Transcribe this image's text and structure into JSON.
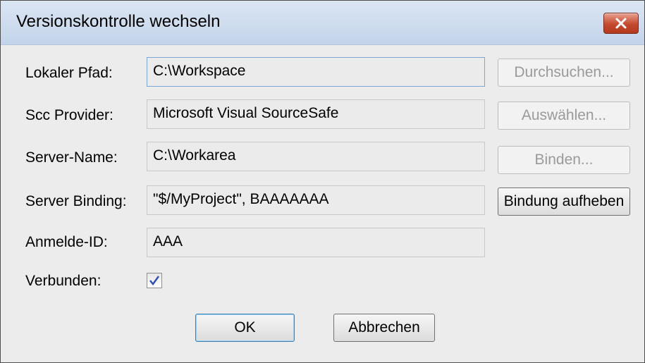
{
  "window": {
    "title": "Versionskontrolle wechseln",
    "close_icon": "close-icon"
  },
  "fields": {
    "local_path": {
      "label": "Lokaler Pfad:",
      "value": "C:\\Workspace"
    },
    "scc_provider": {
      "label": "Scc Provider:",
      "value": "Microsoft Visual SourceSafe"
    },
    "server_name": {
      "label": "Server-Name:",
      "value": "C:\\Workarea"
    },
    "server_binding": {
      "label": "Server Binding:",
      "value": "\"$/MyProject\", BAAAAAAA"
    },
    "login_id": {
      "label": "Anmelde-ID:",
      "value": "AAA"
    }
  },
  "side_buttons": {
    "browse": "Durchsuchen...",
    "select": "Auswählen...",
    "bind": "Binden...",
    "unbind": "Bindung aufheben"
  },
  "connected": {
    "label": "Verbunden:",
    "checked": true
  },
  "buttons": {
    "ok": "OK",
    "cancel": "Abbrechen"
  },
  "colors": {
    "close_button": "#c44a2f",
    "title_bar": "#c3d4ea",
    "dialog_bg": "#ececec"
  }
}
